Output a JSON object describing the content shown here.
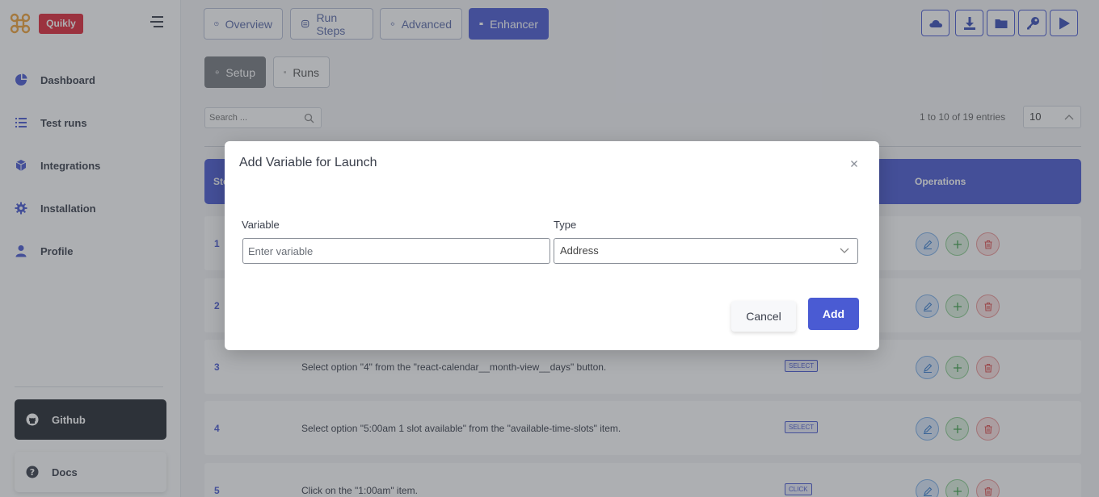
{
  "brand": {
    "name": "Quikly"
  },
  "sidebar": {
    "items": [
      {
        "label": "Dashboard",
        "icon": "pie-chart-icon"
      },
      {
        "label": "Test runs",
        "icon": "list-icon"
      },
      {
        "label": "Integrations",
        "icon": "cube-icon"
      },
      {
        "label": "Installation",
        "icon": "gear-icon"
      },
      {
        "label": "Profile",
        "icon": "user-icon"
      }
    ],
    "github_label": "Github",
    "docs_label": "Docs"
  },
  "tabs": [
    {
      "label": "Overview",
      "active": false
    },
    {
      "label": "Run Steps",
      "active": false
    },
    {
      "label": "Advanced",
      "active": false
    },
    {
      "label": "Enhancer",
      "active": true
    }
  ],
  "sub_tabs": [
    {
      "label": "Setup",
      "active": true
    },
    {
      "label": "Runs",
      "active": false
    }
  ],
  "toolbar": {
    "icons": [
      "cloud-icon",
      "download-icon",
      "folder-icon",
      "key-icon",
      "play-icon"
    ]
  },
  "search": {
    "placeholder": "Search ..."
  },
  "pagination": {
    "entries_text": "1 to 10 of 19 entries",
    "page_size": "10"
  },
  "table": {
    "header_step": "Ste",
    "header_operations": "Operations",
    "rows": [
      {
        "num": "1",
        "desc": "",
        "badge": ""
      },
      {
        "num": "2",
        "desc": "",
        "badge": ""
      },
      {
        "num": "3",
        "desc": "Select option \"4\" from the \"react-calendar__month-view__days\" button.",
        "badge": "SELECT"
      },
      {
        "num": "4",
        "desc": "Select option \"5:00am 1 slot available\" from the \"available-time-slots\" item.",
        "badge": "SELECT"
      },
      {
        "num": "5",
        "desc": "Click on the \"1:00am\" item.",
        "badge": "CLICK"
      }
    ]
  },
  "modal": {
    "title": "Add Variable for Launch",
    "variable_label": "Variable",
    "variable_placeholder": "Enter variable",
    "type_label": "Type",
    "type_value": "Address",
    "cancel_label": "Cancel",
    "add_label": "Add"
  },
  "colors": {
    "accent": "#4a5bd3",
    "brand_red": "#e0283a",
    "github_bg": "#24292f",
    "logo_orange": "#f0a33a"
  }
}
